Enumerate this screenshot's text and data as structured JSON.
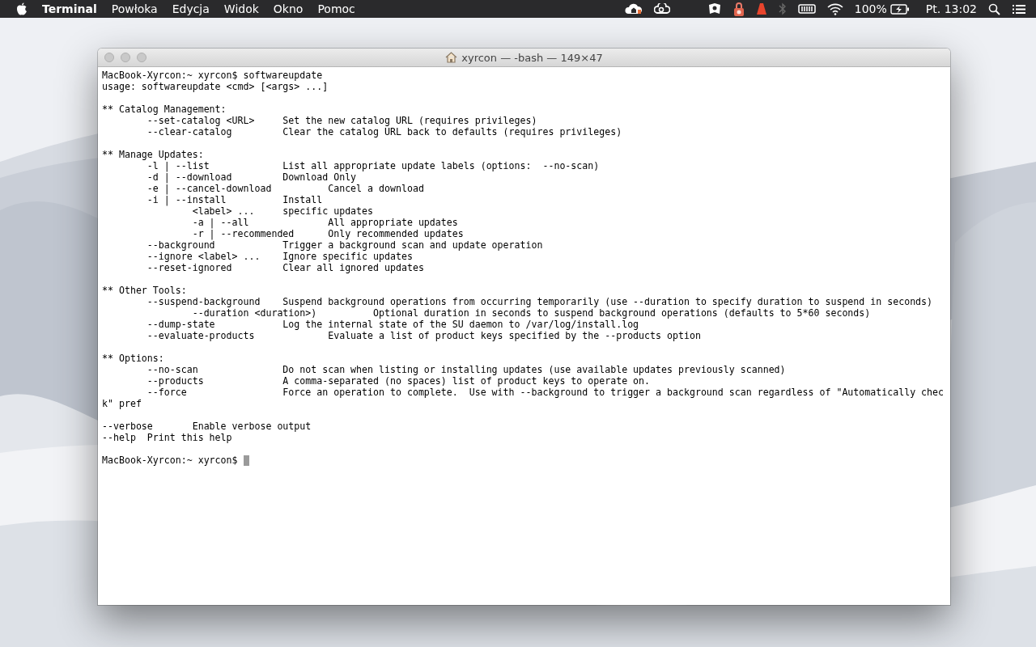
{
  "menu_bar": {
    "app_name": "Terminal",
    "menus": [
      "Powłoka",
      "Edycja",
      "Widok",
      "Okno",
      "Pomoc"
    ],
    "battery_percent": "100%",
    "clock": "Pt. 13:02"
  },
  "window": {
    "title": "xyrcon — -bash — 149×47",
    "lines": [
      {
        "kind": "text",
        "text": "MacBook-Xyrcon:~ xyrcon$ softwareupdate"
      },
      {
        "kind": "text",
        "text": "usage: softwareupdate <cmd> [<args> ...]"
      },
      {
        "kind": "blank"
      },
      {
        "kind": "text",
        "text": "** Catalog Management:"
      },
      {
        "kind": "text",
        "text": "        --set-catalog <URL>     Set the new catalog URL (requires privileges)"
      },
      {
        "kind": "text",
        "text": "        --clear-catalog         Clear the catalog URL back to defaults (requires privileges)"
      },
      {
        "kind": "blank"
      },
      {
        "kind": "text",
        "text": "** Manage Updates:"
      },
      {
        "kind": "text",
        "text": "        -l | --list             List all appropriate update labels (options:  --no-scan)"
      },
      {
        "kind": "text",
        "text": "        -d | --download         Download Only"
      },
      {
        "kind": "text",
        "text": "        -e | --cancel-download          Cancel a download"
      },
      {
        "kind": "text",
        "text": "        -i | --install          Install"
      },
      {
        "kind": "text",
        "text": "                <label> ...     specific updates"
      },
      {
        "kind": "text",
        "text": "                -a | --all              All appropriate updates"
      },
      {
        "kind": "text",
        "text": "                -r | --recommended      Only recommended updates"
      },
      {
        "kind": "text",
        "text": "        --background            Trigger a background scan and update operation"
      },
      {
        "kind": "text",
        "text": "        --ignore <label> ...    Ignore specific updates"
      },
      {
        "kind": "text",
        "text": "        --reset-ignored         Clear all ignored updates"
      },
      {
        "kind": "blank"
      },
      {
        "kind": "text",
        "text": "** Other Tools:"
      },
      {
        "kind": "text",
        "text": "        --suspend-background    Suspend background operations from occurring temporarily (use --duration to specify duration to suspend in seconds)"
      },
      {
        "kind": "text",
        "text": "                --duration <duration>)          Optional duration in seconds to suspend background operations (defaults to 5*60 seconds)"
      },
      {
        "kind": "text",
        "text": "        --dump-state            Log the internal state of the SU daemon to /var/log/install.log"
      },
      {
        "kind": "text",
        "text": "        --evaluate-products             Evaluate a list of product keys specified by the --products option"
      },
      {
        "kind": "blank"
      },
      {
        "kind": "text",
        "text": "** Options:"
      },
      {
        "kind": "text",
        "text": "        --no-scan               Do not scan when listing or installing updates (use available updates previously scanned)"
      },
      {
        "kind": "text",
        "text": "        --products              A comma-separated (no spaces) list of product keys to operate on."
      },
      {
        "kind": "text",
        "text": "        --force                 Force an operation to complete.  Use with --background to trigger a background scan regardless of \"Automatically chec"
      },
      {
        "kind": "text",
        "text": "k\" pref"
      },
      {
        "kind": "blank"
      },
      {
        "kind": "text",
        "text": "--verbose       Enable verbose output"
      },
      {
        "kind": "text",
        "text": "--help  Print this help"
      },
      {
        "kind": "blank"
      },
      {
        "kind": "prompt",
        "text": "MacBook-Xyrcon:~ xyrcon$ "
      }
    ]
  }
}
